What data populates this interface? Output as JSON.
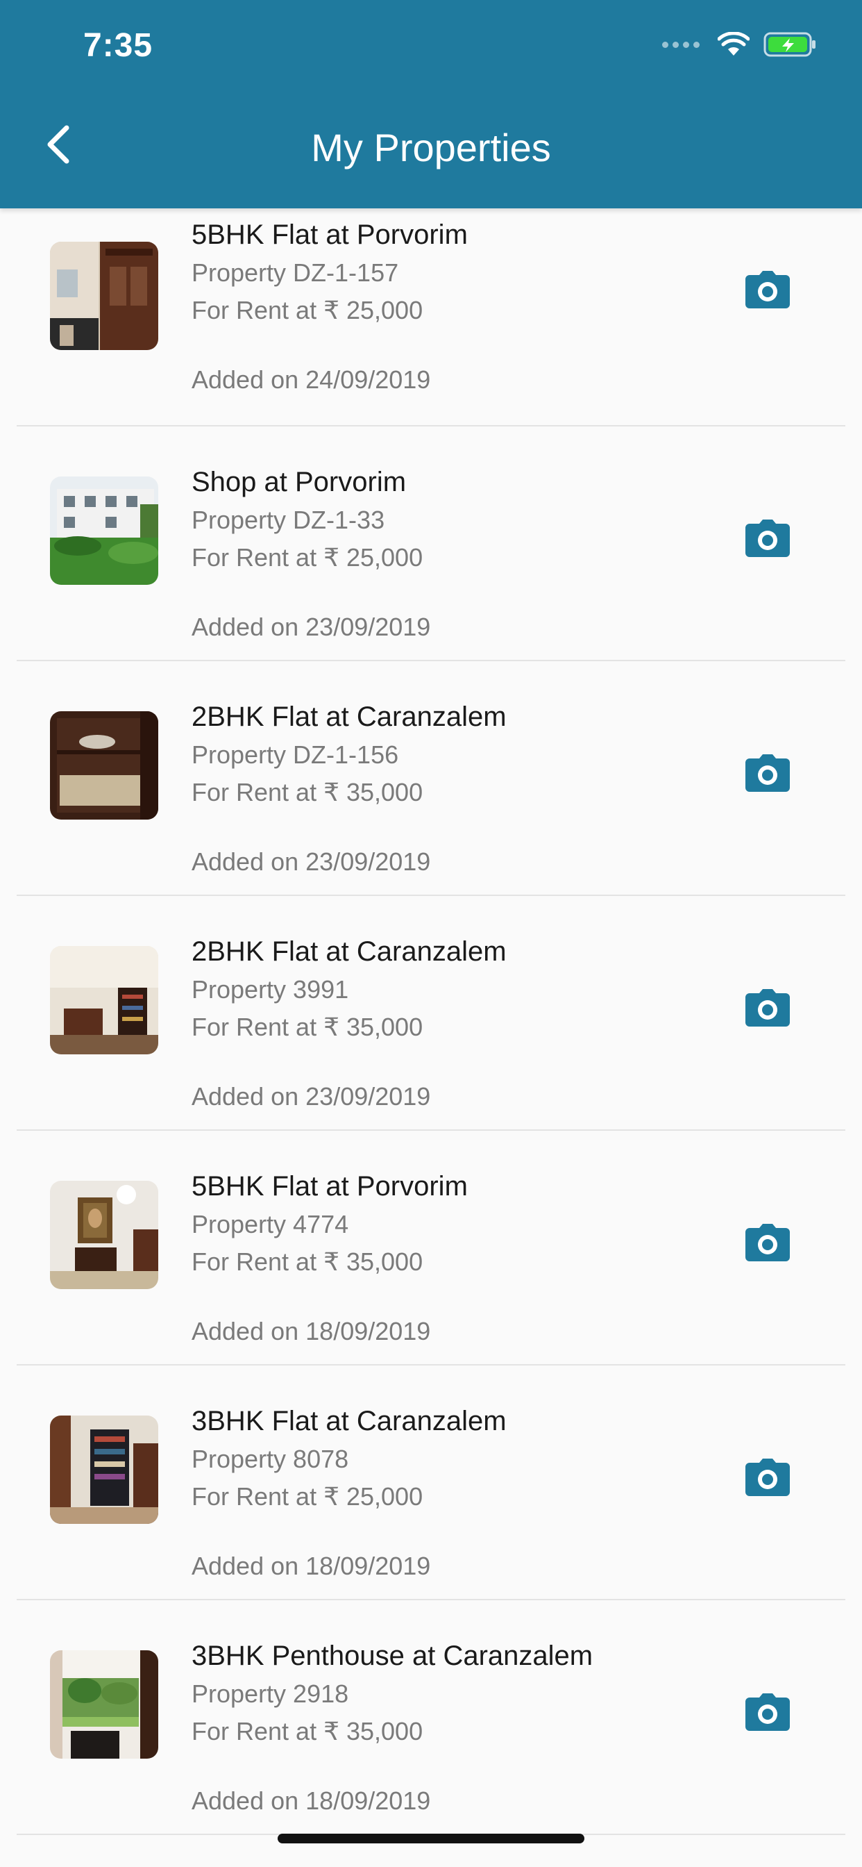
{
  "status_bar": {
    "time": "7:35",
    "battery_color": "#3ddc3d"
  },
  "header": {
    "title": "My Properties",
    "background": "#1f7a9e",
    "back_icon": "chevron-left-icon"
  },
  "properties": [
    {
      "title": "5BHK Flat at Porvorim",
      "property_id": "Property DZ-1-157",
      "price": "For Rent at ₹ 25,000",
      "added": "Added on 24/09/2019",
      "thumbnail": "wardrobe-room-photo"
    },
    {
      "title": "Shop at Porvorim",
      "property_id": "Property DZ-1-33",
      "price": "For Rent at ₹ 25,000",
      "added": "Added on 23/09/2019",
      "thumbnail": "building-exterior-photo"
    },
    {
      "title": "2BHK Flat at Caranzalem",
      "property_id": "Property DZ-1-156",
      "price": "For Rent at ₹ 35,000",
      "added": "Added on 23/09/2019",
      "thumbnail": "cabinet-shelf-photo"
    },
    {
      "title": "2BHK Flat at Caranzalem",
      "property_id": "Property 3991",
      "price": "For Rent at ₹ 35,000",
      "added": "Added on 23/09/2019",
      "thumbnail": "living-room-photo"
    },
    {
      "title": "5BHK Flat at Porvorim",
      "property_id": "Property 4774",
      "price": "For Rent at ₹ 35,000",
      "added": "Added on 18/09/2019",
      "thumbnail": "painting-hallway-photo"
    },
    {
      "title": "3BHK Flat at Caranzalem",
      "property_id": "Property 8078",
      "price": "For Rent at ₹ 25,000",
      "added": "Added on 18/09/2019",
      "thumbnail": "bookshelf-room-photo"
    },
    {
      "title": "3BHK Penthouse at Caranzalem",
      "property_id": "Property 2918",
      "price": "For Rent at ₹ 35,000",
      "added": "Added on 18/09/2019",
      "thumbnail": "garden-view-photo"
    }
  ],
  "row_action_icon": "camera-icon",
  "accent_color": "#1f7a9e"
}
